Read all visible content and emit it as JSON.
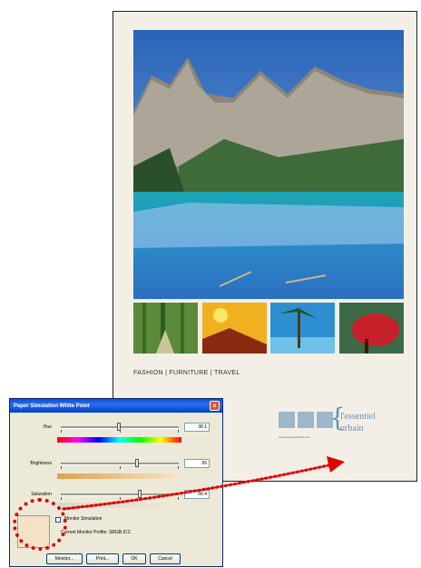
{
  "poster": {
    "tagline": "FASHION  |  FURNITURE  |  TRAVEL",
    "brand_line1": "l'essentiel",
    "brand_line2": "urbain",
    "brand_url": "www.lessentielurbain.com",
    "accent_color": "#6a8fb0"
  },
  "dialog": {
    "title": "Paper Simulation White Point",
    "hue": {
      "label": "Hue",
      "value": "38.1"
    },
    "brightness": {
      "label": "Brightness",
      "value": "65"
    },
    "saturation": {
      "label": "Saturation",
      "value": "66.4"
    },
    "checkbox_label": "Monitor Simulation",
    "profile_label": "Current Monitor Profile:",
    "profile_value": "SRGB.ICC",
    "buttons": {
      "monitor": "Monitor...",
      "print": "Print...",
      "ok": "OK",
      "cancel": "Cancel"
    },
    "swatch_color": "#f3e2c8"
  },
  "annotation": {
    "color": "#e00000"
  }
}
